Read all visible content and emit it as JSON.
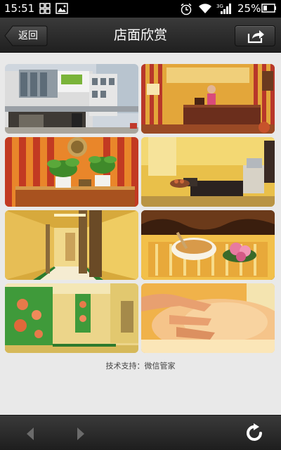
{
  "status_bar": {
    "time": "15:51",
    "battery_percent": "25%",
    "icons": [
      "grid-icon",
      "image-icon",
      "alarm-icon",
      "wifi-icon",
      "signal-3g-icon",
      "battery-icon"
    ]
  },
  "header": {
    "back_label": "返回",
    "title": "店面欣赏",
    "share_icon": "share-icon"
  },
  "gallery": {
    "photos": [
      {
        "name": "storefront-photo"
      },
      {
        "name": "reception-photo"
      },
      {
        "name": "plants-counter-photo"
      },
      {
        "name": "treatment-room-photo"
      },
      {
        "name": "hallway-photo"
      },
      {
        "name": "lotus-bowl-photo"
      },
      {
        "name": "lotus-paintings-room-photo"
      },
      {
        "name": "massage-photo"
      }
    ]
  },
  "footer": {
    "credit": "技术支持：微信管家"
  },
  "bottom_bar": {
    "icons": [
      "back-arrow-icon",
      "forward-arrow-icon",
      "refresh-icon"
    ]
  },
  "colors": {
    "header_bg": "#2b2b2b",
    "page_bg": "#e9e9e9",
    "accent_orange": "#e8792a",
    "accent_yellow": "#f1c232"
  }
}
